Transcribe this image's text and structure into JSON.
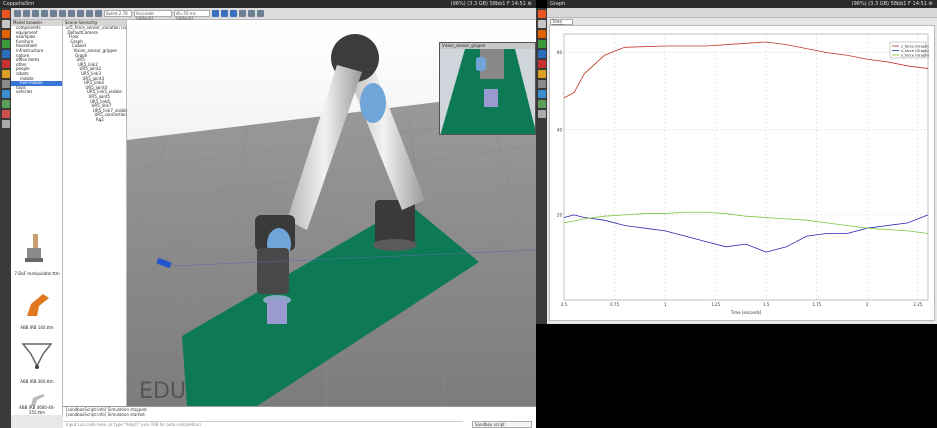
{
  "left_window": {
    "title": "CoppeliaSim",
    "tray_text": "(96%) (3.3 GB)  58bb1 F 14:51 ⚙",
    "toolbar": {
      "sim_engine": "Bullet 2.78",
      "mode": "Accurate (default)",
      "dt": "dt=50 ms (default)"
    },
    "model_browser": {
      "title": "Model browser",
      "items": [
        "components",
        "equipment",
        "examples",
        "furniture",
        "household",
        "infrastructure",
        "nature",
        "office items",
        "other",
        "people",
        "robots",
        "mobile",
        "non-mobile",
        "tools",
        "vehicles"
      ],
      "selected_index": 12,
      "thumbnails": [
        "7-DoF manipulator.ttm",
        "ABB IRB 140.ttm",
        "ABB IRB 360.ttm",
        "ABB IRB 4600-40-255.ttm"
      ]
    },
    "scene_hierarchy": {
      "title": "Scene hierarchy",
      "items": [
        "ur5_force_sensor_variation (scene 1)",
        "DefaultCamera",
        "Floor",
        "Graph",
        "Cuboid",
        "Vision_sensor_gripper",
        "Graph",
        "UR5",
        "UR5_link2",
        "UR5_joint2",
        "UR5_link3",
        "UR5_joint3",
        "UR5_link4",
        "UR5_joint4",
        "UR5_link5_visible",
        "UR5_joint5",
        "UR5_link6",
        "UR5_link7",
        "UR5_link7_visible",
        "UR5_connection",
        "Rg2"
      ]
    },
    "viewport": {
      "thumb_title": "Vision_sensor_gripper",
      "watermark": "EDU"
    },
    "console": {
      "lines": [
        "[sandboxScript:info]   Simulation stopped.",
        "[sandboxScript:info]   Simulation started."
      ],
      "input_placeholder": "Input Lua code here, or type \"help()\" (use TAB for auto-completion)",
      "lang_select": "Sandbox script"
    }
  },
  "right_window": {
    "title": "Graph",
    "tray_text": "(96%) (3.3 GB)  58bb1 F 14:51 ⚙",
    "tab_label": "Time graph",
    "colors": {
      "red": "#c0392b",
      "blue": "#2a2ab0",
      "green": "#7ac943"
    },
    "chart_data": {
      "type": "line",
      "xlabel": "Time [seconds]",
      "x_ticks": [
        "0.5",
        "0.75",
        "1",
        "1.25",
        "1.5",
        "1.75",
        "2",
        "2.25"
      ],
      "series": [
        {
          "name": "z_force (Graph)",
          "color": "#c0392b",
          "x": [
            0.5,
            0.55,
            0.6,
            0.7,
            0.8,
            1.0,
            1.2,
            1.4,
            1.5,
            1.6,
            1.7,
            1.8,
            1.9,
            2.0,
            2.1,
            2.2,
            2.3
          ],
          "y": [
            0.76,
            0.78,
            0.85,
            0.92,
            0.95,
            0.955,
            0.955,
            0.965,
            0.97,
            0.96,
            0.945,
            0.93,
            0.92,
            0.905,
            0.895,
            0.88,
            0.87
          ]
        },
        {
          "name": "x_force (Graph)",
          "color": "#2a2ab0",
          "x": [
            0.5,
            0.55,
            0.6,
            0.7,
            0.8,
            0.9,
            1.0,
            1.1,
            1.2,
            1.3,
            1.4,
            1.5,
            1.6,
            1.7,
            1.8,
            1.9,
            2.0,
            2.1,
            2.2,
            2.3
          ],
          "y": [
            0.31,
            0.32,
            0.31,
            0.3,
            0.28,
            0.27,
            0.26,
            0.24,
            0.22,
            0.2,
            0.21,
            0.18,
            0.2,
            0.24,
            0.25,
            0.25,
            0.27,
            0.28,
            0.29,
            0.32
          ]
        },
        {
          "name": "y_force (Graph)",
          "color": "#7ac943",
          "x": [
            0.5,
            0.6,
            0.7,
            0.8,
            0.9,
            1.0,
            1.1,
            1.2,
            1.3,
            1.4,
            1.5,
            1.6,
            1.7,
            1.8,
            1.9,
            2.0,
            2.1,
            2.2,
            2.3
          ],
          "y": [
            0.29,
            0.305,
            0.315,
            0.32,
            0.325,
            0.325,
            0.33,
            0.33,
            0.325,
            0.315,
            0.31,
            0.305,
            0.3,
            0.29,
            0.28,
            0.27,
            0.265,
            0.26,
            0.25
          ]
        }
      ],
      "xlim": [
        0.5,
        2.3
      ],
      "ylim": [
        0.0,
        1.0
      ],
      "y_tick_values": [
        0.93,
        0.64,
        0.32
      ],
      "y_tick_labels": [
        "60",
        "40",
        "20"
      ],
      "grid": true,
      "legend": "top-right"
    }
  }
}
